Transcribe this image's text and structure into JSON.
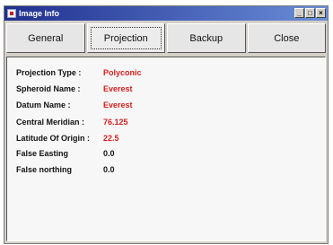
{
  "window": {
    "title": "Image Info"
  },
  "title_buttons": {
    "minimize": "_",
    "maximize": "□",
    "close": "×"
  },
  "tabs": [
    {
      "label": "General",
      "active": false
    },
    {
      "label": "Projection",
      "active": true
    },
    {
      "label": "Backup",
      "active": false
    },
    {
      "label": "Close",
      "active": false
    }
  ],
  "projection": {
    "rows": [
      {
        "label": "Projection Type :",
        "value": "Polyconic",
        "value_color": "#d41f1f"
      },
      {
        "label": "Spheroid Name :",
        "value": "Everest",
        "value_color": "#d41f1f"
      },
      {
        "label": "Datum Name :",
        "value": "Everest",
        "value_color": "#d41f1f"
      },
      {
        "label": "Central Meridian :",
        "value": "76.125",
        "value_color": "#d41f1f"
      },
      {
        "label": "Latitude Of Origin :",
        "value": "22.5",
        "value_color": "#d41f1f"
      },
      {
        "label": "False Easting",
        "value": "0.0",
        "value_color": "#111111"
      },
      {
        "label": "False northing",
        "value": "0.0",
        "value_color": "#111111"
      }
    ]
  }
}
